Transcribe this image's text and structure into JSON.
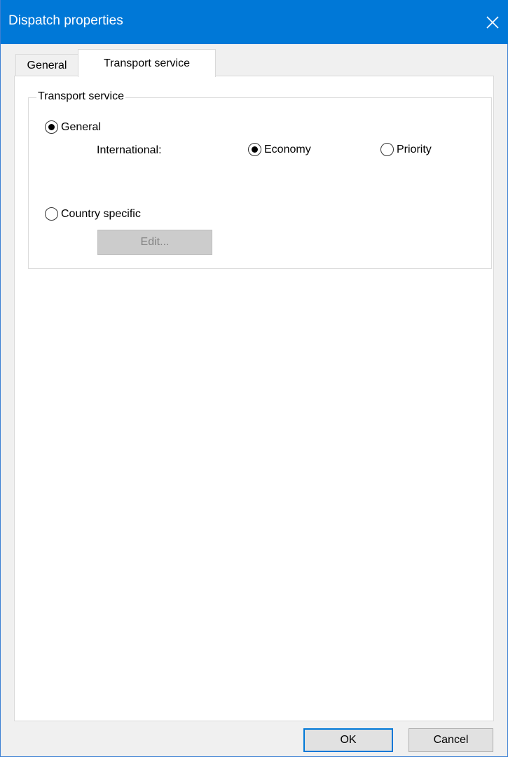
{
  "window": {
    "title": "Dispatch properties"
  },
  "tabs": [
    {
      "label": "General",
      "selected": false
    },
    {
      "label": "Transport service",
      "selected": true
    }
  ],
  "group": {
    "legend": "Transport service",
    "radio_general": {
      "label": "General",
      "checked": true
    },
    "international_label": "International:",
    "radio_economy": {
      "label": "Economy",
      "checked": true
    },
    "radio_priority": {
      "label": "Priority",
      "checked": false
    },
    "radio_country": {
      "label": "Country specific",
      "checked": false
    },
    "edit_button": {
      "label": "Edit...",
      "enabled": false
    }
  },
  "buttons": {
    "ok_label": "OK",
    "cancel_label": "Cancel"
  },
  "colors": {
    "titlebar": "#0078d7",
    "dialog_bg": "#f0f0f0",
    "panel_bg": "#ffffff",
    "default_button_border": "#0078d7"
  }
}
